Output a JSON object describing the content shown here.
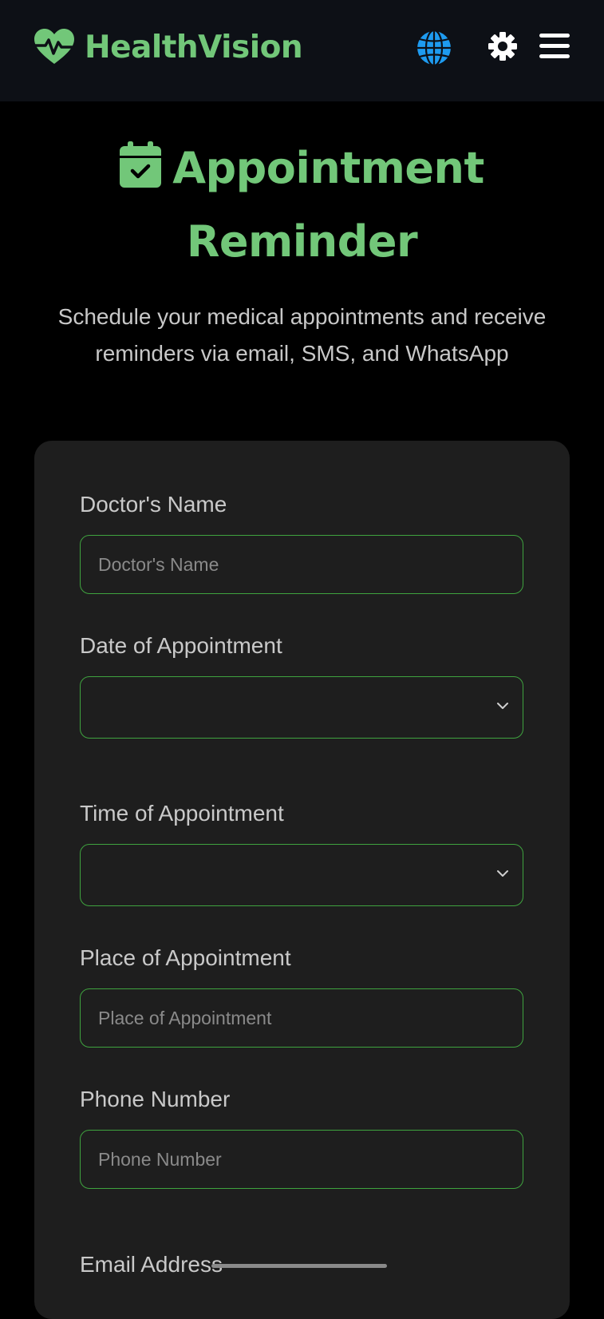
{
  "header": {
    "brand_name": "HealthVision",
    "brand_icon": "heart-pulse-icon",
    "icons": [
      "globe-icon",
      "gear-icon",
      "hamburger-menu-icon"
    ]
  },
  "page": {
    "title_line1": "Appointment",
    "title_line2": "Reminder",
    "title_icon": "calendar-check-icon",
    "subtitle": "Schedule your medical appointments and receive reminders via email, SMS, and WhatsApp"
  },
  "form": {
    "doctor_name": {
      "label": "Doctor's Name",
      "placeholder": "Doctor's Name",
      "value": ""
    },
    "date": {
      "label": "Date of Appointment",
      "value": ""
    },
    "time": {
      "label": "Time of Appointment",
      "value": ""
    },
    "place": {
      "label": "Place of Appointment",
      "placeholder": "Place of Appointment",
      "value": ""
    },
    "phone": {
      "label": "Phone Number",
      "placeholder": "Phone Number",
      "value": ""
    },
    "email": {
      "label": "Email Address"
    }
  },
  "colors": {
    "accent_green": "#72c779",
    "input_border": "#3fa33f",
    "topbar_bg": "#0d1016",
    "card_bg": "#1e1e1e",
    "globe_blue": "#1e9bf0"
  }
}
